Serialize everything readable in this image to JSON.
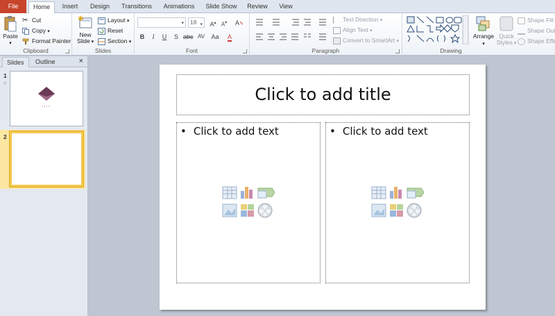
{
  "tabs": [
    "File",
    "Home",
    "Insert",
    "Design",
    "Transitions",
    "Animations",
    "Slide Show",
    "Review",
    "View"
  ],
  "active_tab": "Home",
  "clipboard": {
    "paste": "Paste",
    "cut": "Cut",
    "copy": "Copy",
    "format_painter": "Format Painter",
    "label": "Clipboard"
  },
  "slides_group": {
    "new_slide_line1": "New",
    "new_slide_line2": "Slide",
    "layout": "Layout",
    "reset": "Reset",
    "section": "Section",
    "label": "Slides"
  },
  "font": {
    "family": "",
    "size": "18",
    "label": "Font"
  },
  "paragraph": {
    "text_direction": "Text Direction",
    "align_text": "Align Text",
    "convert_smartart": "Convert to SmartArt",
    "label": "Paragraph"
  },
  "drawing": {
    "arrange": "Arrange",
    "quick_styles_line1": "Quick",
    "quick_styles_line2": "Styles",
    "shape_fill": "Shape Fill",
    "shape_outline": "Shape Out",
    "shape_effects": "Shape Effe",
    "label": "Drawing"
  },
  "pane": {
    "tab_slides": "Slides",
    "tab_outline": "Outline",
    "close": "×",
    "slide1_num": "1",
    "slide2_num": "2"
  },
  "slide": {
    "title_placeholder": "Click to add title",
    "left_placeholder": "Click to add text",
    "right_placeholder": "Click to add text"
  },
  "colors": {
    "file_tab": "#c8442a",
    "selection": "#f3c84e"
  }
}
